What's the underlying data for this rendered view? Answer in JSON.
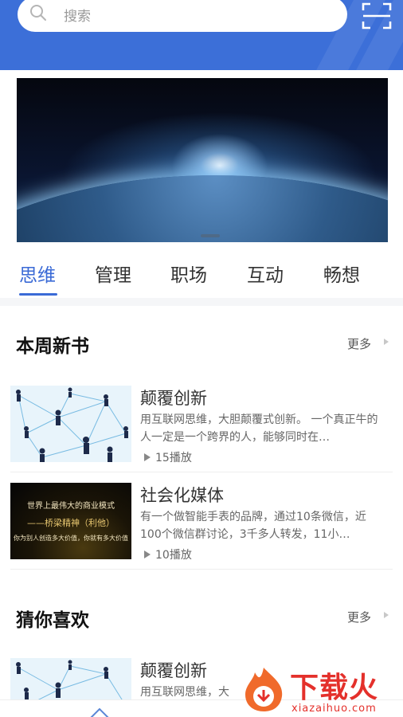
{
  "search": {
    "placeholder": "搜索"
  },
  "tabs": [
    "思维",
    "管理",
    "职场",
    "互动",
    "畅想"
  ],
  "sections": {
    "weekly": {
      "title": "本周新书",
      "more": "更多"
    },
    "guess": {
      "title": "猜你喜欢",
      "more": "更多"
    }
  },
  "weekly_items": [
    {
      "title": "颠覆创新",
      "desc": "用互联网思维，大胆颠覆式创新。 一个真正牛的人一定是一个跨界的人，能够同时在…",
      "plays": "15播放"
    },
    {
      "title": "社会化媒体",
      "desc": "有一个做智能手表的品牌，通过10条微信，近100个微信群讨论，3千多人转发，11小…",
      "plays": "10播放"
    }
  ],
  "thumb_dark": {
    "line1": "世界上最伟大的商业模式",
    "line2": "——桥梁精神（利他）",
    "line3": "你为别人创造多大价值，你就有多大价值"
  },
  "guess_items": [
    {
      "title": "颠覆创新",
      "desc": "用互联网思维，大"
    }
  ],
  "watermark": {
    "cn": "下载火",
    "en": "xiazaihuo.com"
  },
  "colors": {
    "header": "#3c6fd8",
    "accent": "#3a6ad6",
    "brand_red": "#e4302b"
  }
}
